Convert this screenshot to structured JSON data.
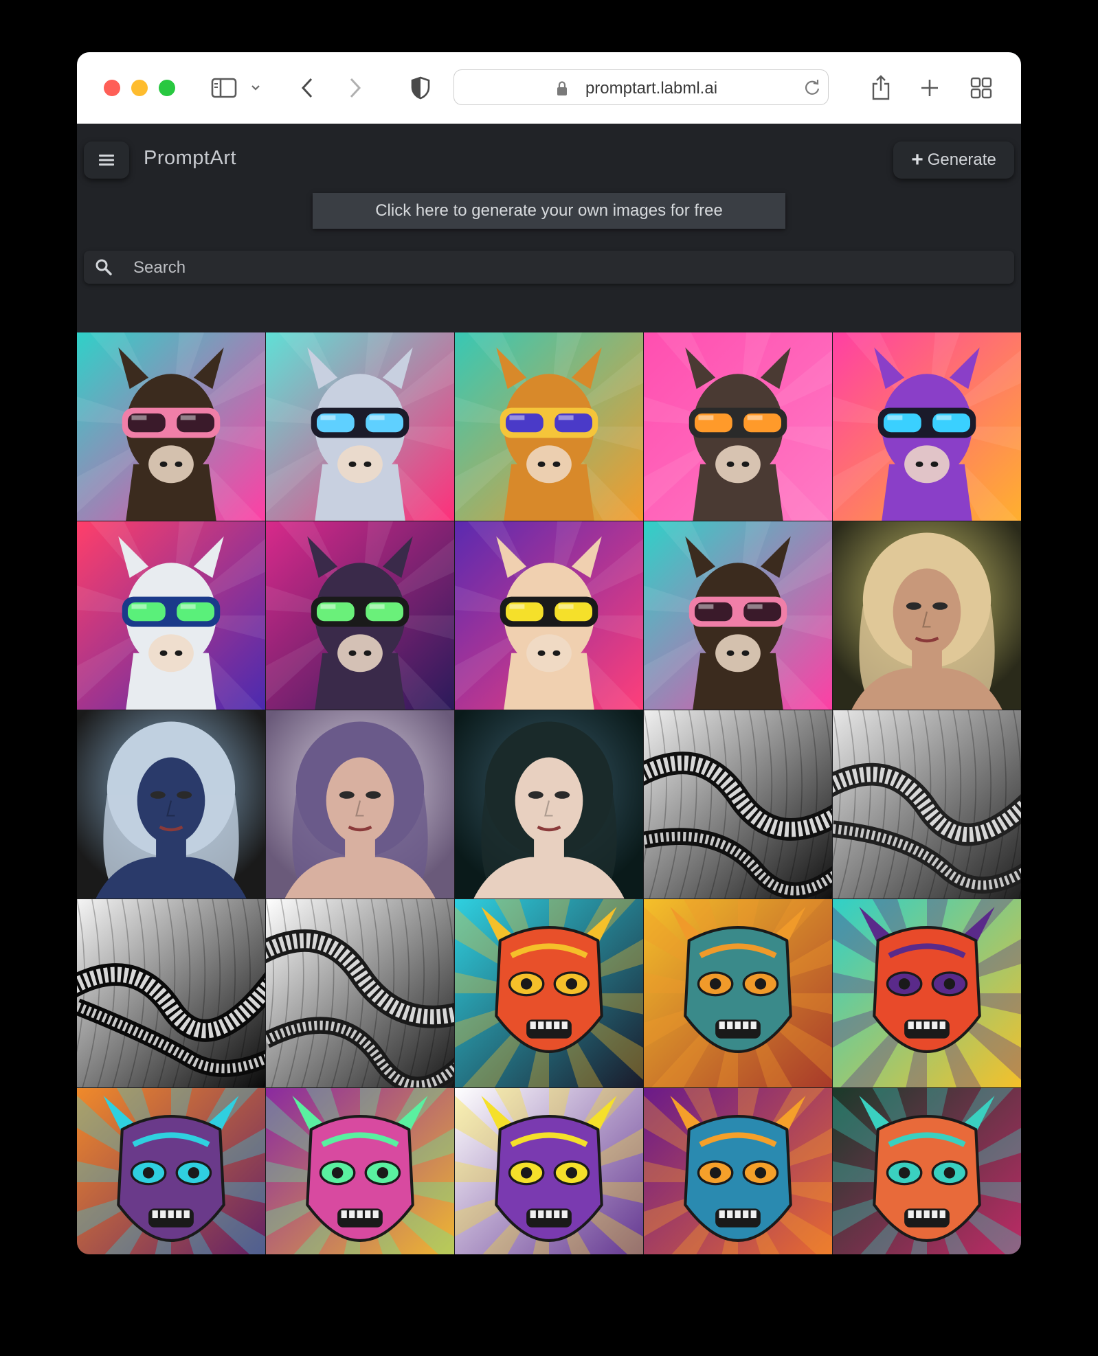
{
  "browser": {
    "url": "promptart.labml.ai"
  },
  "app": {
    "brand": "PromptArt",
    "generate_label": "Generate",
    "promo_text": "Click here to generate your own images for free",
    "search_placeholder": "Search"
  },
  "gallery": [
    {
      "kind": "llama",
      "bg1": "#2fd1c8",
      "bg2": "#ff3fa4",
      "fur": "#3b2b1e",
      "glasses": "#f07fa8",
      "lens": "#3a1a2a"
    },
    {
      "kind": "llama",
      "bg1": "#5fe0d6",
      "bg2": "#ff2f7a",
      "fur": "#c8d0e0",
      "glasses": "#1b1b2a",
      "lens": "#5fd0ff"
    },
    {
      "kind": "llama",
      "bg1": "#37c8b5",
      "bg2": "#f59b2a",
      "fur": "#d8892a",
      "glasses": "#f5c53a",
      "lens": "#4a3ac8"
    },
    {
      "kind": "llama",
      "bg1": "#ff4fb0",
      "bg2": "#ff7ac4",
      "fur": "#4a3a33",
      "glasses": "#2a2a2a",
      "lens": "#ff9a2a"
    },
    {
      "kind": "llama",
      "bg1": "#ff3fa4",
      "bg2": "#ffb02e",
      "fur": "#8a3fc8",
      "glasses": "#1a1a2a",
      "lens": "#3ad0ff"
    },
    {
      "kind": "llama",
      "bg1": "#ff3f6a",
      "bg2": "#4a2ab0",
      "fur": "#e8ecf0",
      "glasses": "#1a3a8a",
      "lens": "#5af07a"
    },
    {
      "kind": "llama",
      "bg1": "#d82a8a",
      "bg2": "#2a1a5a",
      "fur": "#3a2a4a",
      "glasses": "#1a1a1a",
      "lens": "#6af07a"
    },
    {
      "kind": "llama",
      "bg1": "#5a2ab0",
      "bg2": "#ff3f7a",
      "fur": "#f0d0b0",
      "glasses": "#1a1a1a",
      "lens": "#f5e02a"
    },
    {
      "kind": "llama",
      "bg1": "#2fd1c8",
      "bg2": "#ff3fa4",
      "fur": "#3b2b1e",
      "glasses": "#f07fa8",
      "lens": "#3a1a2a"
    },
    {
      "kind": "face",
      "bg1": "#c8c06a",
      "bg2": "#2a2a1a",
      "skin": "#c8987a",
      "hair": "#e0c898"
    },
    {
      "kind": "face",
      "bg1": "#8ab0d0",
      "bg2": "#1a1a1a",
      "skin": "#2a3a6a",
      "hair": "#c0d0e0"
    },
    {
      "kind": "face",
      "bg1": "#d8d0e0",
      "bg2": "#6a5a7a",
      "skin": "#d8b0a0",
      "hair": "#6a5a8a"
    },
    {
      "kind": "face",
      "bg1": "#3a5a6a",
      "bg2": "#0a1a1a",
      "skin": "#e8d0c0",
      "hair": "#1a2a2a"
    },
    {
      "kind": "snake",
      "bg1": "#f0f0f0",
      "bg2": "#101010"
    },
    {
      "kind": "snake",
      "bg1": "#e8e8e8",
      "bg2": "#202020"
    },
    {
      "kind": "snake",
      "bg1": "#f5f5f5",
      "bg2": "#0a0a0a"
    },
    {
      "kind": "snake",
      "bg1": "#ffffff",
      "bg2": "#1a1a1a"
    },
    {
      "kind": "mask",
      "bg1": "#2fd0e0",
      "bg2": "#1a1a2a",
      "face": "#e8502a",
      "accent": "#f5c02a"
    },
    {
      "kind": "mask",
      "bg1": "#f5c02a",
      "bg2": "#a83a2a",
      "face": "#3a8a8a",
      "accent": "#f09a2a"
    },
    {
      "kind": "mask",
      "bg1": "#2fd0c8",
      "bg2": "#f5c02a",
      "face": "#e84a2a",
      "accent": "#5a2a8a"
    },
    {
      "kind": "mask",
      "bg1": "#f08a2a",
      "bg2": "#5a1a6a",
      "face": "#6a3a8a",
      "accent": "#2fd0e0"
    },
    {
      "kind": "mask",
      "bg1": "#8a2aa0",
      "bg2": "#f5c02a",
      "face": "#d84aa0",
      "accent": "#5af0a0"
    },
    {
      "kind": "mask",
      "bg1": "#ffffff",
      "bg2": "#5a2a8a",
      "face": "#7a3ab0",
      "accent": "#f5e02a"
    },
    {
      "kind": "mask",
      "bg1": "#6a1a8a",
      "bg2": "#f0702a",
      "face": "#2a8ab0",
      "accent": "#f5a02a"
    },
    {
      "kind": "mask",
      "bg1": "#1a3a2a",
      "bg2": "#c82a6a",
      "face": "#e86a3a",
      "accent": "#3ad0c0"
    }
  ]
}
